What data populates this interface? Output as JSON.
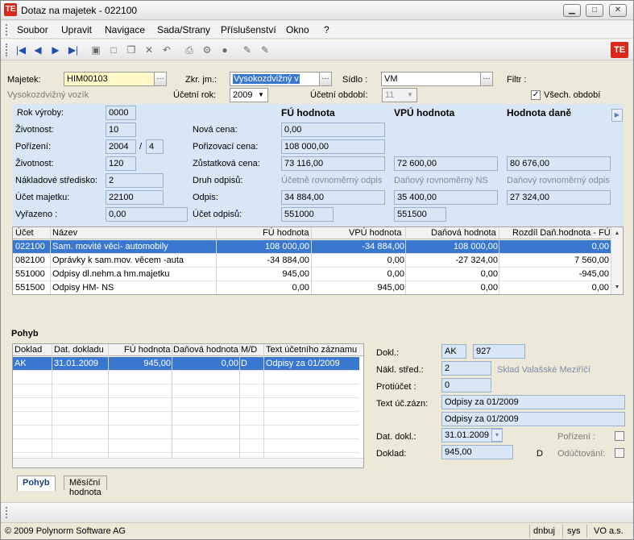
{
  "window": {
    "title": "Dotaz na majetek - 022100",
    "app_icon": "TE",
    "minimize": "▁",
    "maximize": "□",
    "close": "✕"
  },
  "menu": [
    "Soubor",
    "Upravit",
    "Navigace",
    "Sada/Strany",
    "Příslušenství",
    "Okno",
    "?"
  ],
  "logo": "TE",
  "header": {
    "majetek_label": "Majetek:",
    "majetek_value": "HIM00103",
    "majetek_desc": "Vysokozdvižný vozík",
    "zkr_label": "Zkr. jm.:",
    "zkr_value": "Vysokozdvižný v",
    "sidlo_label": "Sídlo   :",
    "sidlo_value": "VM",
    "filtr_label": "Filtr :",
    "ucetni_rok_label": "Účetní rok:",
    "ucetni_rok_value": "2009",
    "ucetni_obdobi_label": "Účetní období:",
    "ucetni_obdobi_value": "11",
    "vsech_obdobi_label": "Všech. období",
    "vsech_obdobi_checked": "✓"
  },
  "details": {
    "rok_vyroby_label": "Rok výroby:",
    "rok_vyroby": "0000",
    "zivotnost1_label": "Životnost:",
    "zivotnost1": "10",
    "porizeni_label": "Pořízení:",
    "porizeni_rok": "2004",
    "porizeni_sep": "/",
    "porizeni_mesic": "4",
    "zivotnost2_label": "Životnost:",
    "zivotnost2": "120",
    "nakladove_label": "Nákladové středisko:",
    "nakladove": "2",
    "ucet_majetku_label": "Účet majetku:",
    "ucet_majetku": "22100",
    "vyrazeno_label": "Vyřazeno   :",
    "vyrazeno": "0,00",
    "col_fu": "FÚ hodnota",
    "col_vpu": "VPÚ hodnota",
    "col_dan": "Hodnota daně",
    "nova_cena_label": "Nová cena:",
    "nova_cena_fu": "0,00",
    "porizovaci_label": "Pořizovací cena:",
    "porizovaci_fu": "108 000,00",
    "zustatkova_label": "Zůstatková cena:",
    "zustatkova_fu": "73 116,00",
    "zustatkova_vpu": "72 600,00",
    "zustatkova_dan": "80 676,00",
    "druh_label": "Druh odpisů:",
    "druh_fu": "Účetně rovnoměrný odpis",
    "druh_vpu": "Daňový rovnoměrný NS",
    "druh_dan": "Daňový rovnoměrný odpis",
    "odpis_label": "Odpis:",
    "odpis_fu": "34 884,00",
    "odpis_vpu": "35 400,00",
    "odpis_dan": "27 324,00",
    "ucet_odpisu_label": "Účet odpisů:",
    "ucet_odpisu_fu": "551000",
    "ucet_odpisu_vpu": "551500"
  },
  "accounts_table": {
    "headers": [
      "Účet",
      "Název",
      "FÚ hodnota",
      "VPÚ hodnota",
      "Daňová hodnota",
      "Rozdíl Daň.hodnota - FÚ"
    ],
    "rows": [
      [
        "022100",
        "Sam. movité věci- automobily",
        "108 000,00",
        "-34 884,00",
        "108 000,00",
        "0,00"
      ],
      [
        "082100",
        "Oprávky k sam.mov. věcem -auta",
        "-34 884,00",
        "0,00",
        "-27 324,00",
        "7 560,00"
      ],
      [
        "551000",
        "Odpisy dl.nehm.a hm.majetku",
        "945,00",
        "0,00",
        "0,00",
        "-945,00"
      ],
      [
        "551500",
        "Odpisy HM- NS",
        "0,00",
        "945,00",
        "0,00",
        "0,00"
      ]
    ]
  },
  "pohyb": {
    "section_title": "Pohyb",
    "headers": [
      "Doklad",
      "Dat. dokladu",
      "FÚ hodnota",
      "Daňová hodnota",
      "M/D",
      "Text účetního záznamu"
    ],
    "rows": [
      [
        "AK",
        "31.01.2009",
        "945,00",
        "0,00",
        "D",
        "Odpisy za 01/2009"
      ]
    ]
  },
  "pohyb_detail": {
    "dokl_label": "Dokl.:",
    "dokl_type": "AK",
    "dokl_num": "927",
    "nakl_label": "Nákl. střed.:",
    "nakl_value": "2",
    "nakl_desc": "Sklad Valašské Meziříčí",
    "protiucet_label": "Protiúčet :",
    "protiucet_value": "0",
    "text_label": "Text úč.zázn:",
    "text_value1": "Odpisy za 01/2009",
    "text_value2": "Odpisy za 01/2009",
    "dat_label": "Dat. dokl.:",
    "dat_value": "31.01.2009",
    "porizeni_label": "Pořízení   :",
    "doklad_label": "Doklad:",
    "doklad_value": "945,00",
    "doklad_md": "D",
    "oductovani_label": "Odúčtování:"
  },
  "tabs": [
    "Pohyb",
    "Měsíční hodnota"
  ],
  "status": {
    "copyright": "© 2009 Polynorm Software AG",
    "user": "dnbuj",
    "db": "sys",
    "company": "VO a.s."
  }
}
